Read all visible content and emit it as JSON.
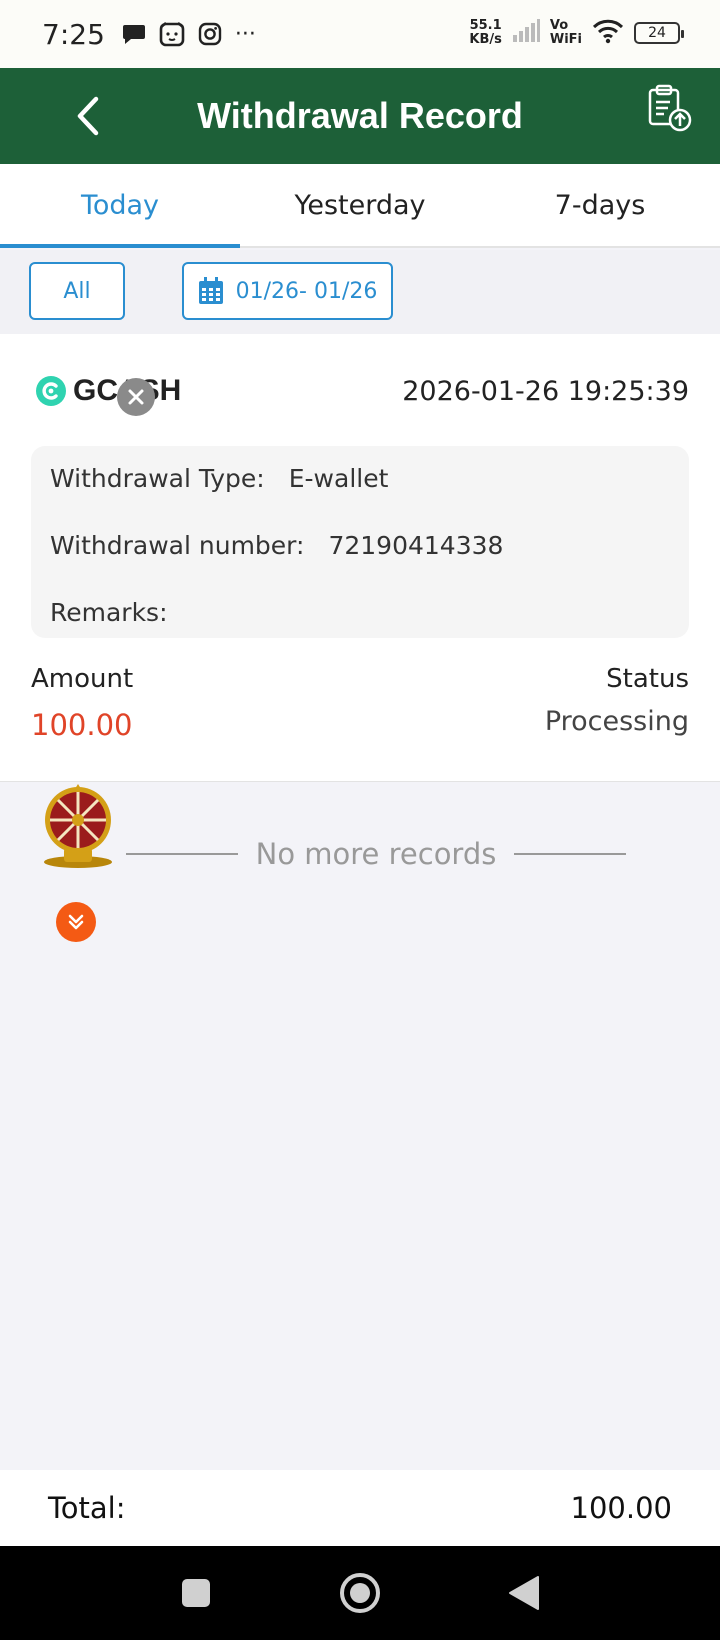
{
  "status_bar": {
    "time": "7:25",
    "more": "···",
    "net_speed_value": "55.1",
    "net_speed_unit": "KB/s",
    "vowifi_top": "Vo",
    "vowifi_bottom": "WiFi",
    "battery": "24"
  },
  "header": {
    "title": "Withdrawal Record",
    "back_icon": "chevron-left-icon",
    "action_icon": "clipboard-upload-icon",
    "bg_color": "#1d6038"
  },
  "tabs": [
    {
      "label": "Today",
      "active": true
    },
    {
      "label": "Yesterday",
      "active": false
    },
    {
      "label": "7-days",
      "active": false
    }
  ],
  "filters": {
    "all_label": "All",
    "date_range": "01/26- 01/26",
    "accent_color": "#2a8ed0"
  },
  "record": {
    "brand": "GCASH",
    "datetime": "2026-01-26 19:25:39",
    "details": [
      {
        "label": "Withdrawal Type:",
        "value": "E-wallet"
      },
      {
        "label": "Withdrawal number:",
        "value": "72190414338"
      },
      {
        "label": "Remarks:",
        "value": ""
      }
    ],
    "amount_label": "Amount",
    "amount_value": "100.00",
    "amount_color": "#e04428",
    "status_label": "Status",
    "status_value": "Processing"
  },
  "list_end": {
    "text": "No more records"
  },
  "footer": {
    "total_label": "Total:",
    "total_value": "100.00"
  }
}
